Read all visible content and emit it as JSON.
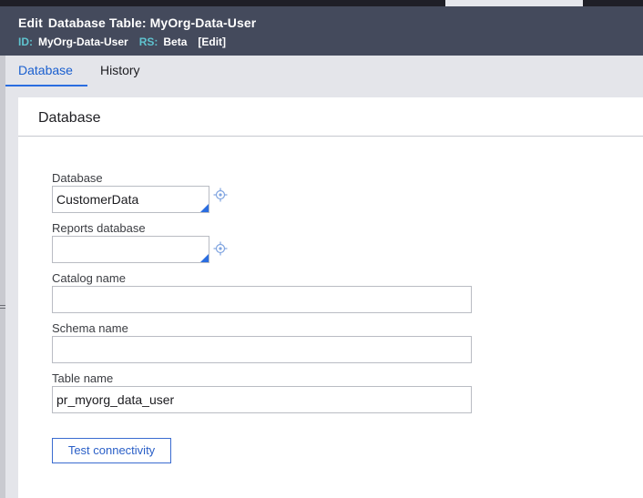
{
  "header": {
    "title_prefix": "Edit",
    "title_rest": "Database Table: MyOrg-Data-User",
    "id_label": "ID:",
    "id_value": "MyOrg-Data-User",
    "rs_label": "RS:",
    "rs_value": "Beta",
    "edit_link": "[Edit]"
  },
  "tabs": [
    {
      "label": "Database",
      "active": true
    },
    {
      "label": "History",
      "active": false
    }
  ],
  "panel": {
    "title": "Database",
    "fields": {
      "database": {
        "label": "Database",
        "value": "CustomerData"
      },
      "reports_database": {
        "label": "Reports database",
        "value": ""
      },
      "catalog_name": {
        "label": "Catalog name",
        "value": ""
      },
      "schema_name": {
        "label": "Schema name",
        "value": ""
      },
      "table_name": {
        "label": "Table name",
        "value": "pr_myorg_data_user"
      }
    },
    "test_button": "Test connectivity"
  },
  "colors": {
    "header_bg": "#444a5c",
    "accent": "#2a6de0",
    "meta_label": "#5fc3cf"
  },
  "icons": {
    "picker": "crosshair-icon"
  }
}
